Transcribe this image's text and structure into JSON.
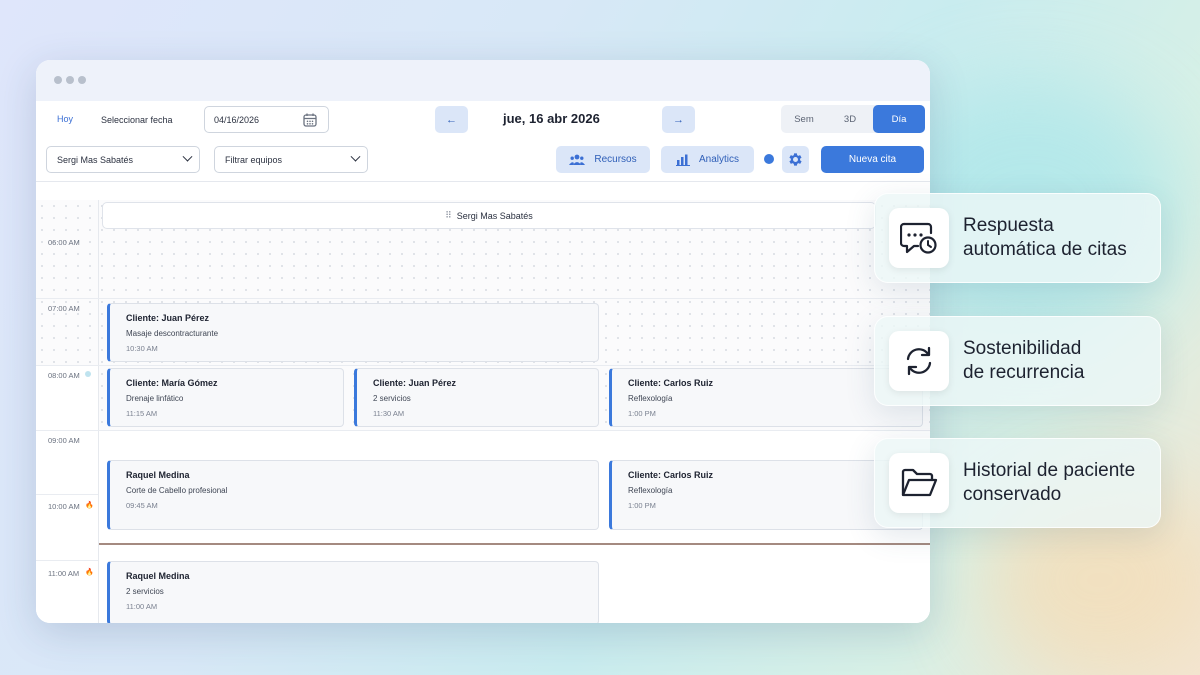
{
  "toolbar": {
    "today": "Hoy",
    "select_date_label": "Seleccionar fecha",
    "date_value": "04/16/2026",
    "prev": "←",
    "next": "→",
    "date_title": "jue, 16 abr 2026",
    "views": [
      "Sem",
      "3D",
      "Día"
    ],
    "active_view": "Día",
    "staff_select": "Sergi Mas Sabatés",
    "equipment_select": "Filtrar equipos",
    "resources_button": "Recursos",
    "analytics_button": "Analytics",
    "new_appointment": "Nueva cita"
  },
  "calendar": {
    "resource_name": "Sergi Mas Sabatés",
    "hours": [
      "06:00 AM",
      "07:00 AM",
      "08:00 AM",
      "09:00 AM",
      "10:00 AM",
      "11:00 AM"
    ],
    "events": [
      {
        "title": "Cliente: Juan Pérez",
        "subtitle": "Masaje descontracturante",
        "time": "10:30 AM"
      },
      {
        "title": "Cliente: María Gómez",
        "subtitle": "Drenaje linfático",
        "time": "11:15 AM"
      },
      {
        "title": "Cliente: Juan Pérez",
        "subtitle": "2 servicios",
        "time": "11:30 AM"
      },
      {
        "title": "Cliente: Carlos Ruiz",
        "subtitle": "Reflexología",
        "time": "1:00 PM"
      },
      {
        "title": "Raquel Medina",
        "subtitle": "Corte de Cabello profesional",
        "time": "09:45 AM"
      },
      {
        "title": "Cliente: Carlos Ruiz",
        "subtitle": "Reflexología",
        "time": "1:00 PM"
      },
      {
        "title": "Raquel Medina",
        "subtitle": "2 servicios",
        "time": "11:00 AM"
      }
    ]
  },
  "features": [
    {
      "line1": "Respuesta",
      "line2": "automática de citas",
      "icon": "chat-clock-icon"
    },
    {
      "line1": "Sostenibilidad",
      "line2": "de recurrencia",
      "icon": "refresh-icon"
    },
    {
      "line1": "Historial de paciente",
      "line2": "conservado",
      "icon": "folder-icon"
    }
  ],
  "colors": {
    "accent": "#3b79dc",
    "accent_light": "#dbe6f8",
    "now_line": "#a48a80"
  }
}
